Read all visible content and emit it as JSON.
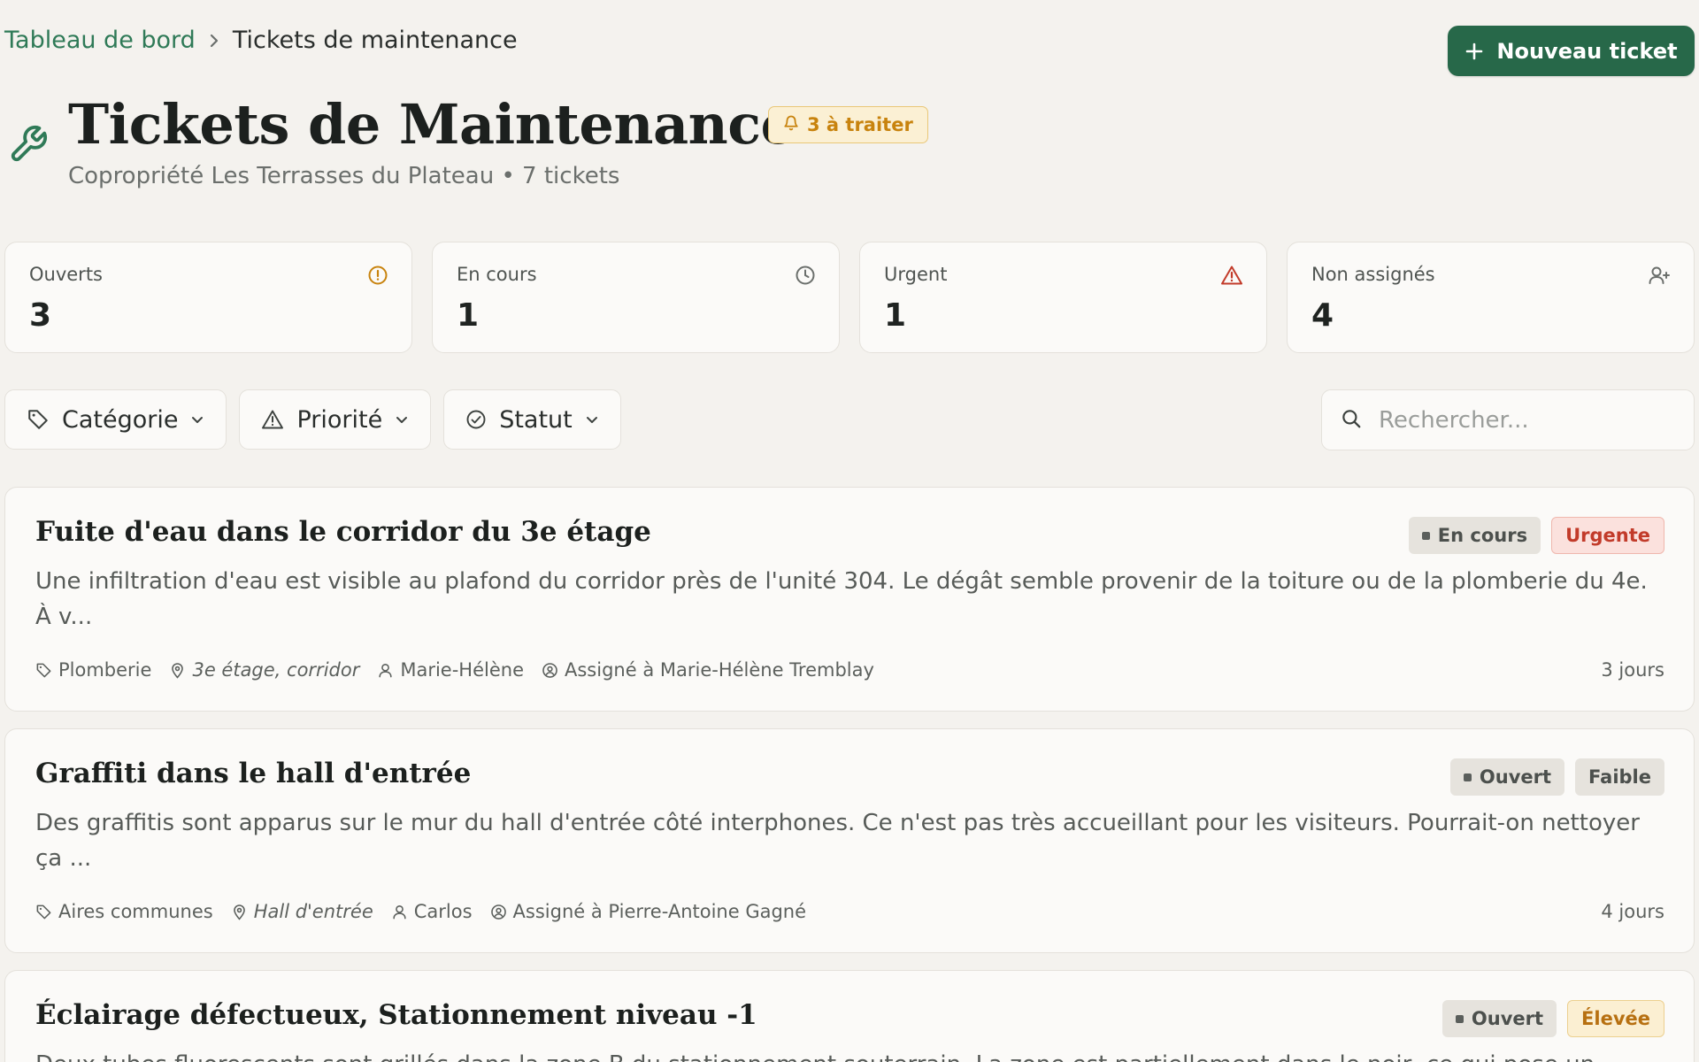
{
  "breadcrumb": {
    "home": "Tableau de bord",
    "current": "Tickets de maintenance"
  },
  "actions": {
    "new_ticket": "Nouveau ticket"
  },
  "header": {
    "title": "Tickets de Maintenance",
    "todo_badge": "3 à traiter",
    "subtitle": "Copropriété Les Terrasses du Plateau • 7 tickets"
  },
  "stats": [
    {
      "label": "Ouverts",
      "value": "3",
      "icon": "alert-circle-icon",
      "color": "#c8830e"
    },
    {
      "label": "En cours",
      "value": "1",
      "icon": "clock-icon",
      "color": "#6b6f6c"
    },
    {
      "label": "Urgent",
      "value": "1",
      "icon": "alert-triangle-icon",
      "color": "#c23b2a"
    },
    {
      "label": "Non assignés",
      "value": "4",
      "icon": "user-plus-icon",
      "color": "#6b6f6c"
    }
  ],
  "filters": {
    "category": "Catégorie",
    "priority": "Priorité",
    "status": "Statut"
  },
  "search": {
    "placeholder": "Rechercher..."
  },
  "tickets": [
    {
      "title": "Fuite d'eau dans le corridor du 3e étage",
      "status": "En cours",
      "priority": "Urgente",
      "description": "Une infiltration d'eau est visible au plafond du corridor près de l'unité 304. Le dégât semble provenir de la toiture ou de la plomberie du 4e. À v...",
      "category": "Plomberie",
      "location": "3e étage, corridor",
      "reporter": "Marie-Hélène",
      "assignee": "Assigné à Marie-Hélène Tremblay",
      "age": "3 jours"
    },
    {
      "title": "Graffiti dans le hall d'entrée",
      "status": "Ouvert",
      "priority": "Faible",
      "description": "Des graffitis sont apparus sur le mur du hall d'entrée côté interphones. Ce n'est pas très accueillant pour les visiteurs. Pourrait-on nettoyer ça ...",
      "category": "Aires communes",
      "location": "Hall d'entrée",
      "reporter": "Carlos",
      "assignee": "Assigné à Pierre-Antoine Gagné",
      "age": "4 jours"
    },
    {
      "title": "Éclairage défectueux, Stationnement niveau -1",
      "status": "Ouvert",
      "priority": "Élevée",
      "description": "Deux tubes fluorescents sont grillés dans la zone B du stationnement souterrain. La zone est partiellement dans le noir, ce qui pose un"
    }
  ],
  "colors": {
    "accent": "#276849",
    "background": "#f4f2ee",
    "card": "#fbfaf8"
  }
}
